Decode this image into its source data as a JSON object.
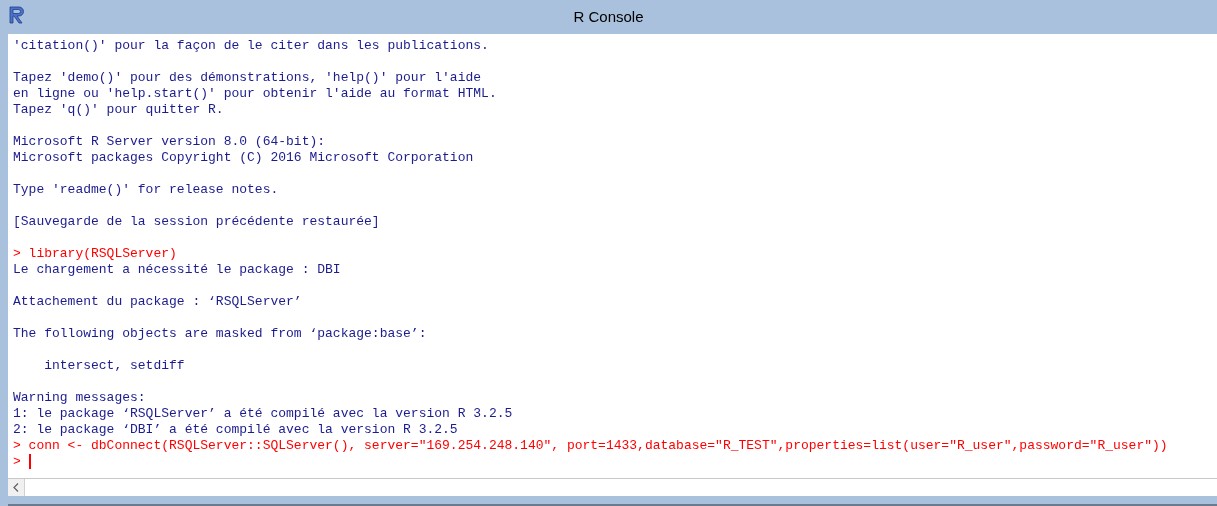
{
  "window": {
    "title": "R Console"
  },
  "console": {
    "lines": [
      {
        "kind": "output",
        "text": "'citation()' pour la façon de le citer dans les publications."
      },
      {
        "kind": "blank"
      },
      {
        "kind": "output",
        "text": "Tapez 'demo()' pour des démonstrations, 'help()' pour l'aide"
      },
      {
        "kind": "output",
        "text": "en ligne ou 'help.start()' pour obtenir l'aide au format HTML."
      },
      {
        "kind": "output",
        "text": "Tapez 'q()' pour quitter R."
      },
      {
        "kind": "blank"
      },
      {
        "kind": "output",
        "text": "Microsoft R Server version 8.0 (64-bit):"
      },
      {
        "kind": "output",
        "text": "Microsoft packages Copyright (C) 2016 Microsoft Corporation"
      },
      {
        "kind": "blank"
      },
      {
        "kind": "output",
        "text": "Type 'readme()' for release notes."
      },
      {
        "kind": "blank"
      },
      {
        "kind": "output",
        "text": "[Sauvegarde de la session précédente restaurée]"
      },
      {
        "kind": "blank"
      },
      {
        "kind": "input",
        "prompt": ">",
        "text": "library(RSQLServer)"
      },
      {
        "kind": "output",
        "text": "Le chargement a nécessité le package : DBI"
      },
      {
        "kind": "blank"
      },
      {
        "kind": "output",
        "text": "Attachement du package : ‘RSQLServer’"
      },
      {
        "kind": "blank"
      },
      {
        "kind": "output",
        "text": "The following objects are masked from ‘package:base’:"
      },
      {
        "kind": "blank"
      },
      {
        "kind": "output",
        "text": "    intersect, setdiff"
      },
      {
        "kind": "blank"
      },
      {
        "kind": "output",
        "text": "Warning messages:"
      },
      {
        "kind": "output",
        "text": "1: le package ‘RSQLServer’ a été compilé avec la version R 3.2.5"
      },
      {
        "kind": "output",
        "text": "2: le package ‘DBI’ a été compilé avec la version R 3.2.5"
      },
      {
        "kind": "input",
        "prompt": ">",
        "text": "conn <- dbConnect(RSQLServer::SQLServer(), server=\"169.254.248.140\", port=1433,database=\"R_TEST\",properties=list(user=\"R_user\",password=\"R_user\"))"
      },
      {
        "kind": "cursor",
        "prompt": ">"
      }
    ]
  }
}
